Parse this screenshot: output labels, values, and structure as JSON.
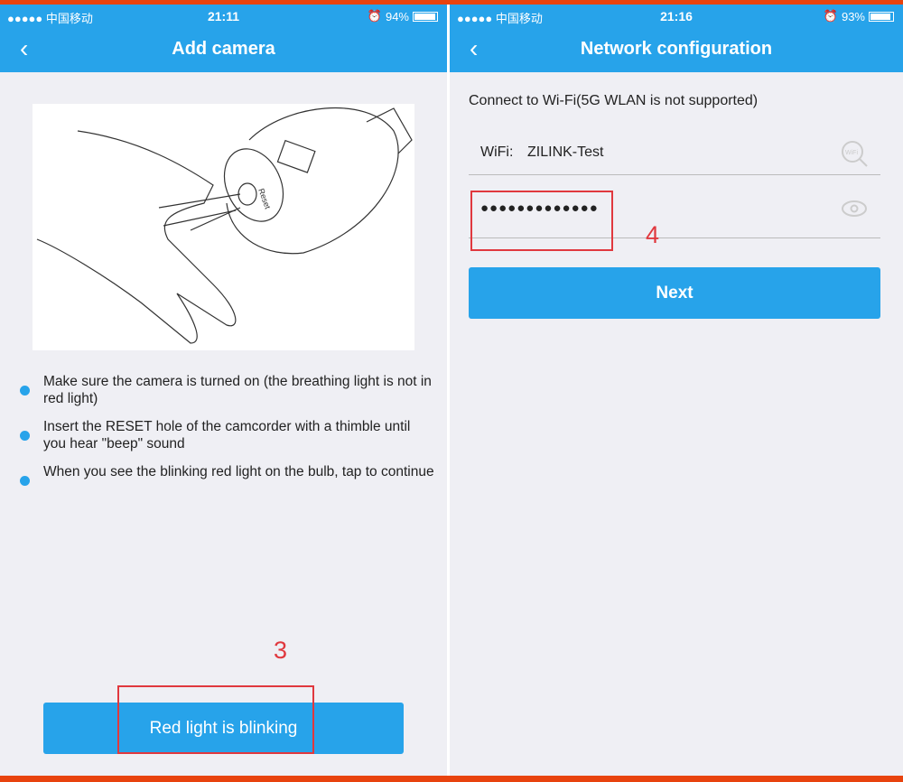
{
  "left": {
    "status": {
      "carrier": "●●●●● 中国移动",
      "time": "21:11",
      "battery": "94%",
      "battery_level": 0.94
    },
    "title": "Add camera",
    "illustration_label": "Reset",
    "bullets": [
      "Make sure the camera is turned on (the breathing light is not in red light)",
      "Insert the RESET hole of the camcorder with a thimble until you hear \"beep\" sound",
      "When you see the blinking red light on the bulb, tap to continue"
    ],
    "button": "Red light is blinking",
    "annotation": "3"
  },
  "right": {
    "status": {
      "carrier": "●●●●● 中国移动",
      "time": "21:16",
      "battery": "93%",
      "battery_level": 0.93
    },
    "title": "Network configuration",
    "notice": "Connect to Wi-Fi(5G WLAN is not supported)",
    "wifi_label": "WiFi:",
    "wifi_name": "ZILINK-Test",
    "password": "●●●●●●●●●●●●●",
    "button": "Next",
    "annotation": "4"
  },
  "colors": {
    "accent": "#27a3ea",
    "annotation": "#e0383e",
    "frame": "#e8430e"
  }
}
